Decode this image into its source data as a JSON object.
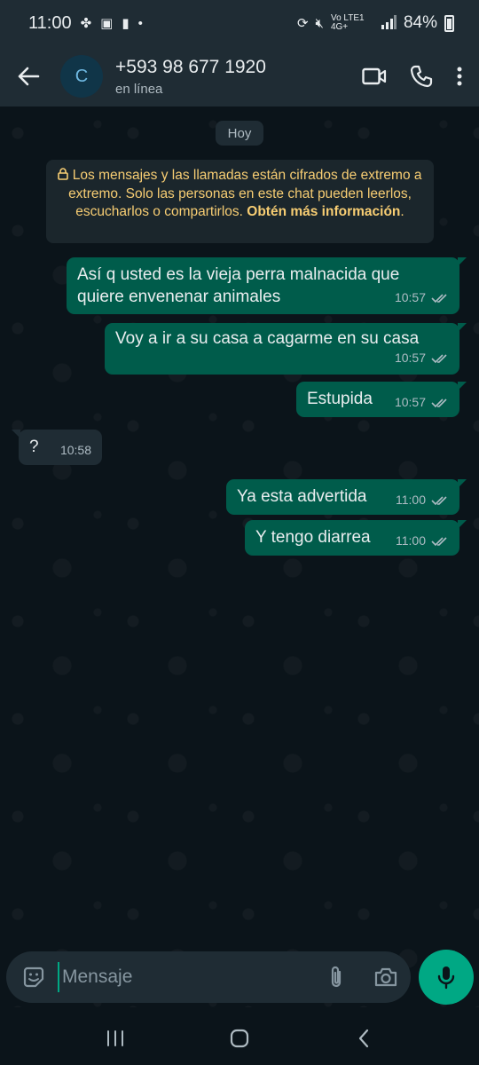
{
  "status_bar": {
    "time": "11:00",
    "network_label": "Vo LTE1 4G+",
    "battery": "84%"
  },
  "header": {
    "avatar_letter": "C",
    "contact_name": "+593 98 677 1920",
    "contact_status": "en línea",
    "icons": [
      "back-arrow-icon",
      "video-call-icon",
      "phone-icon",
      "more-options-icon"
    ]
  },
  "chat": {
    "date_label": "Hoy",
    "encryption_notice": {
      "text": "Los mensajes y las llamadas están cifrados de extremo a extremo. Solo las personas en este chat pueden leerlos, escucharlos o compartirlos.",
      "link": "Obtén más información",
      "end": "."
    },
    "messages": [
      {
        "direction": "out",
        "text": "Así q usted es la vieja perra malnacida que quiere envenenar animales",
        "time": "10:57",
        "status": "read"
      },
      {
        "direction": "out",
        "text": "Voy a ir a su casa a cagarme en su casa",
        "time": "10:57",
        "status": "read"
      },
      {
        "direction": "out",
        "text": "Estupida",
        "time": "10:57",
        "status": "read"
      },
      {
        "direction": "in",
        "text": "?",
        "time": "10:58"
      },
      {
        "direction": "out",
        "text": "Ya esta advertida",
        "time": "11:00",
        "status": "read"
      },
      {
        "direction": "out",
        "text": "Y tengo diarrea",
        "time": "11:00",
        "status": "read"
      }
    ]
  },
  "input": {
    "placeholder": "Mensaje",
    "value": ""
  },
  "colors": {
    "background": "#0b141a",
    "header": "#1f2c34",
    "outgoing_bubble": "#005c4b",
    "incoming_bubble": "#1f2c34",
    "accent": "#00a884",
    "read_tick": "#8696a0",
    "notice_text": "#f7cd73"
  }
}
